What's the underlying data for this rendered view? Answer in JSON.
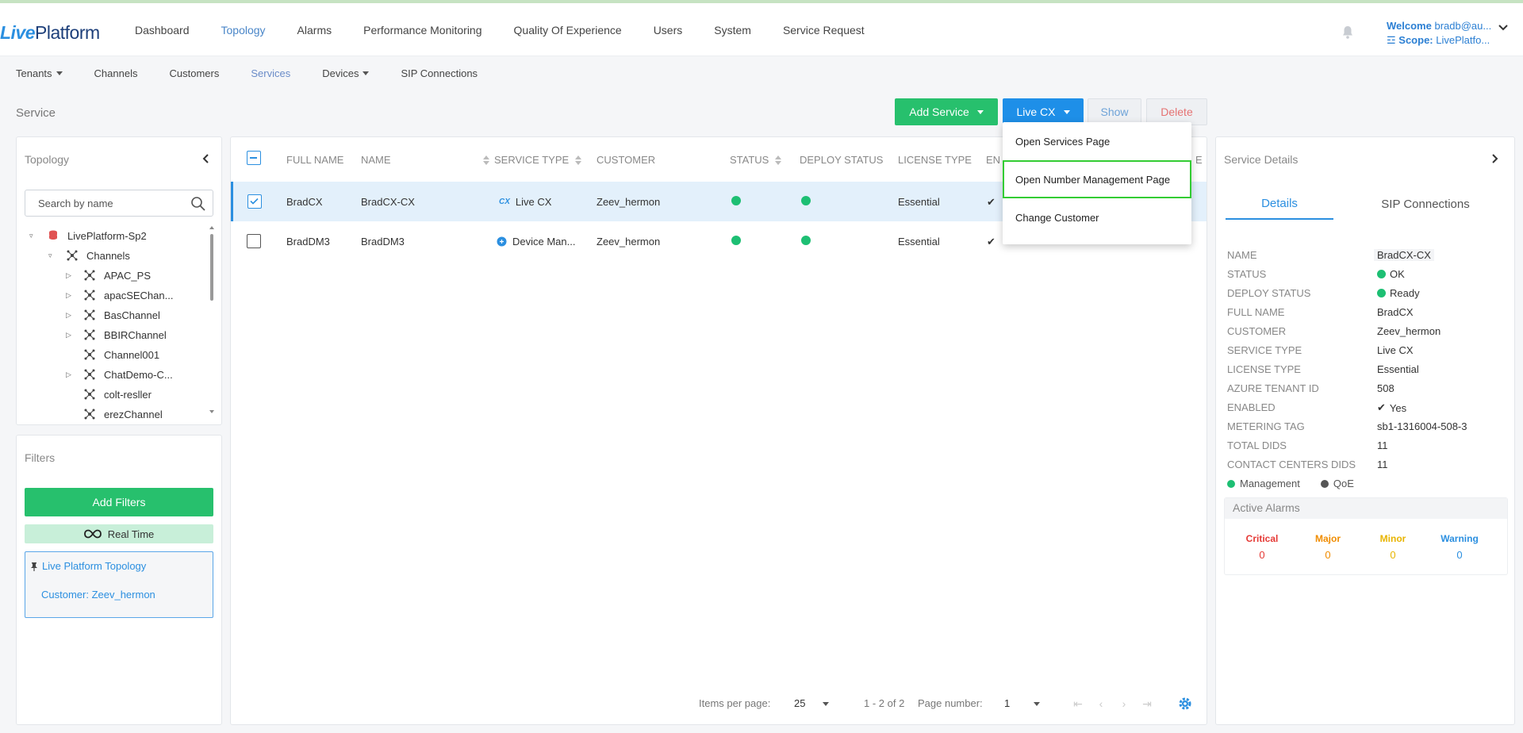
{
  "header": {
    "logo_part1": "Live",
    "logo_part2": "Platform",
    "nav": [
      "Dashboard",
      "Topology",
      "Alarms",
      "Performance Monitoring",
      "Quality Of Experience",
      "Users",
      "System",
      "Service Request"
    ],
    "active_nav": "Topology",
    "welcome_label": "Welcome",
    "welcome_value": "bradb@au...",
    "scope_label": "Scope:",
    "scope_value": "LivePlatfo..."
  },
  "subnav": {
    "items": [
      "Tenants",
      "Channels",
      "Customers",
      "Services",
      "Devices",
      "SIP Connections"
    ],
    "active": "Services"
  },
  "page": {
    "title": "Service"
  },
  "actions": {
    "add_service": "Add Service",
    "live_cx": "Live CX",
    "show": "Show",
    "delete": "Delete"
  },
  "dropdown": {
    "items": [
      "Open Services Page",
      "Open Number Management Page",
      "Change Customer"
    ],
    "highlighted": "Open Number Management Page"
  },
  "topology": {
    "title": "Topology",
    "search_placeholder": "Search by name",
    "tree": [
      {
        "label": "LivePlatform-Sp2",
        "level": 0,
        "toggle": "expanded",
        "icon": "database-icon"
      },
      {
        "label": "Channels",
        "level": 1,
        "toggle": "expanded",
        "icon": "network-icon"
      },
      {
        "label": "APAC_PS",
        "level": 2,
        "toggle": "collapsed",
        "icon": "network-icon"
      },
      {
        "label": "apacSEChan...",
        "level": 2,
        "toggle": "collapsed",
        "icon": "network-icon"
      },
      {
        "label": "BasChannel",
        "level": 2,
        "toggle": "collapsed",
        "icon": "network-icon"
      },
      {
        "label": "BBIRChannel",
        "level": 2,
        "toggle": "collapsed",
        "icon": "network-icon"
      },
      {
        "label": "Channel001",
        "level": 2,
        "toggle": "none",
        "icon": "network-icon"
      },
      {
        "label": "ChatDemo-C...",
        "level": 2,
        "toggle": "collapsed",
        "icon": "network-icon"
      },
      {
        "label": "colt-resller",
        "level": 2,
        "toggle": "none",
        "icon": "network-icon"
      },
      {
        "label": "erezChannel",
        "level": 2,
        "toggle": "none",
        "icon": "network-icon"
      }
    ]
  },
  "filters": {
    "title": "Filters",
    "add_filters": "Add Filters",
    "real_time": "Real Time",
    "scope_title": "Live Platform Topology",
    "scope_customer": "Customer: Zeev_hermon"
  },
  "table": {
    "columns": [
      "FULL NAME",
      "NAME",
      "SERVICE TYPE",
      "CUSTOMER",
      "STATUS",
      "DEPLOY STATUS",
      "LICENSE TYPE",
      "EN"
    ],
    "trailing_header": "E",
    "rows": [
      {
        "full_name": "BradCX",
        "name": "BradCX-CX",
        "service_type": "Live CX",
        "service_icon": "cx-icon",
        "customer": "Zeev_hermon",
        "status": "ok",
        "deploy": "ready",
        "license": "Essential",
        "enabled": "✔",
        "selected": true
      },
      {
        "full_name": "BradDM3",
        "name": "BradDM3",
        "service_type": "Device Man...",
        "service_icon": "device-manager-icon",
        "customer": "Zeev_hermon",
        "status": "ok",
        "deploy": "ready",
        "license": "Essential",
        "enabled": "✔",
        "selected": false
      }
    ]
  },
  "pagination": {
    "items_per_page_label": "Items per page:",
    "items_per_page": "25",
    "range": "1 - 2 of 2",
    "page_number_label": "Page number:",
    "page_number": "1"
  },
  "details": {
    "title": "Service Details",
    "tabs": [
      "Details",
      "SIP Connections"
    ],
    "active_tab": "Details",
    "fields": [
      {
        "label": "NAME",
        "value": "BradCX-CX"
      },
      {
        "label": "STATUS",
        "value": "OK",
        "indicator": "green"
      },
      {
        "label": "DEPLOY STATUS",
        "value": "Ready",
        "indicator": "green"
      },
      {
        "label": "FULL NAME",
        "value": "BradCX"
      },
      {
        "label": "CUSTOMER",
        "value": "Zeev_hermon"
      },
      {
        "label": "SERVICE TYPE",
        "value": "Live CX"
      },
      {
        "label": "LICENSE TYPE",
        "value": "Essential"
      },
      {
        "label": "AZURE TENANT ID",
        "value": "508"
      },
      {
        "label": "ENABLED",
        "value": "Yes",
        "indicator": "check"
      },
      {
        "label": "METERING TAG",
        "value": "sb1-1316004-508-3"
      },
      {
        "label": "TOTAL DIDS",
        "value": "11"
      },
      {
        "label": "CONTACT CENTERS DIDS",
        "value": "11"
      }
    ],
    "legend": [
      {
        "label": "Management",
        "color": "#1dbf73"
      },
      {
        "label": "QoE",
        "color": "#555555"
      }
    ],
    "active_alarms_title": "Active Alarms",
    "alarms": [
      {
        "label": "Critical",
        "value": "0",
        "color": "#e53935"
      },
      {
        "label": "Major",
        "value": "0",
        "color": "#f08c00"
      },
      {
        "label": "Minor",
        "value": "0",
        "color": "#e8b400"
      },
      {
        "label": "Warning",
        "value": "0",
        "color": "#2b8fe0"
      }
    ]
  },
  "colors": {
    "accent_blue": "#2b8fe0",
    "green": "#27c06d",
    "highlight_outline": "#33cc33"
  }
}
